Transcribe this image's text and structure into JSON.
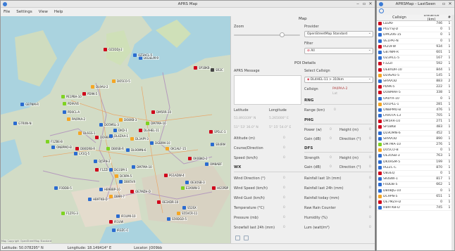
{
  "main_window": {
    "title": "APRS Map",
    "menu": [
      "File",
      "Settings",
      "View",
      "Help"
    ]
  },
  "map": {
    "copyright": "Map Copyright OpenStreetMap Standard",
    "stations": [
      {
        "label": "DO2ELM-9",
        "color": "#2a6bd1"
      },
      {
        "label": "OZ2DDJ-2",
        "color": "#d0021b"
      },
      {
        "label": "OZ3ACL-5",
        "color": "#2a6bd1"
      },
      {
        "label": "SP1BKB",
        "color": "#d0021b"
      },
      {
        "label": "SR2C",
        "color": "#444"
      },
      {
        "label": "DL9AU-2",
        "color": "#f5a623"
      },
      {
        "label": "DO5CO-5",
        "color": "#f5a623"
      },
      {
        "label": "PE1PBA-10",
        "color": "#7ed321"
      },
      {
        "label": "PD9K-5",
        "color": "#d0021b"
      },
      {
        "label": "GB7NM-R",
        "color": "#2a6bd1"
      },
      {
        "label": "PD9VVE",
        "color": "#7ed321"
      },
      {
        "label": "PD0CL-A",
        "color": "#2a6bd1"
      },
      {
        "label": "PA0PAA-2",
        "color": "#f5a623"
      },
      {
        "label": "G7RXN-N",
        "color": "#2a6bd1"
      },
      {
        "label": "F1ZBE-B",
        "color": "#7ed321"
      },
      {
        "label": "ON8PMO-B",
        "color": "#2a6bd1"
      },
      {
        "label": "DB0DRB-R",
        "color": "#d0021b"
      },
      {
        "label": "LX1CJ-5",
        "color": "#2a6bd1"
      },
      {
        "label": "DL6GS-1",
        "color": "#f5a623"
      },
      {
        "label": "DO9RAS-5",
        "color": "#d0021b"
      },
      {
        "label": "DO5MSL-3",
        "color": "#2a6bd1"
      },
      {
        "label": "DO8XB-3",
        "color": "#f5a623"
      },
      {
        "label": "DM5RR-10",
        "color": "#d0021b"
      },
      {
        "label": "DKD-1",
        "color": "#2a6bd1"
      },
      {
        "label": "DM7MA-10",
        "color": "#7ed321"
      },
      {
        "label": "DL4HEL-11",
        "color": "#d0021b"
      },
      {
        "label": "DL4ZAA-1",
        "color": "#2a6bd1"
      },
      {
        "label": "DL3APY-3",
        "color": "#f5a623"
      },
      {
        "label": "DG8RM-10",
        "color": "#2a6bd1"
      },
      {
        "label": "SP5LC-1",
        "color": "#d0021b"
      },
      {
        "label": "SR4RM",
        "color": "#2a6bd1"
      },
      {
        "label": "OK1ALF-15",
        "color": "#f5a623"
      },
      {
        "label": "DL9OMN-6",
        "color": "#2a6bd1"
      },
      {
        "label": "DB0SB-R",
        "color": "#7ed321"
      },
      {
        "label": "DM7MA-10",
        "color": "#2a6bd1"
      },
      {
        "label": "OK0BKO-2",
        "color": "#d0021b"
      },
      {
        "label": "OM8ABF",
        "color": "#2a6bd1"
      },
      {
        "label": "F1ZZI",
        "color": "#d0021b"
      },
      {
        "label": "DG1SM-1",
        "color": "#2a6bd1"
      },
      {
        "label": "DC9PA-5",
        "color": "#f5a623"
      },
      {
        "label": "DB05VX",
        "color": "#2a6bd1"
      },
      {
        "label": "PG1ADW-4",
        "color": "#d0021b"
      },
      {
        "label": "OE3OSB-3",
        "color": "#2a6bd1"
      },
      {
        "label": "E3XWW-3",
        "color": "#7ed321"
      },
      {
        "label": "HG5PBP",
        "color": "#d0021b"
      },
      {
        "label": "F0DDB-5",
        "color": "#2a6bd1"
      },
      {
        "label": "HB9BBP-10",
        "color": "#2a6bd1"
      },
      {
        "label": "DB9R-7",
        "color": "#f5a623"
      },
      {
        "label": "OE7MZH-D",
        "color": "#d0021b"
      },
      {
        "label": "HB9TKB-D",
        "color": "#2a6bd1"
      },
      {
        "label": "F1ZFG-3",
        "color": "#7ed321"
      },
      {
        "label": "IR1UMI-10",
        "color": "#2a6bd1"
      },
      {
        "label": "OE3XDR-10",
        "color": "#d0021b"
      },
      {
        "label": "S52SX",
        "color": "#2a6bd1"
      },
      {
        "label": "S55VCR-11",
        "color": "#f5a623"
      },
      {
        "label": "S59DGO-5",
        "color": "#2a6bd1"
      },
      {
        "label": "IR1UW",
        "color": "#d0021b"
      },
      {
        "label": "IR2ZC-C",
        "color": "#2a6bd1"
      },
      {
        "label": "DJ5RN-2",
        "color": "#2a6bd1"
      }
    ]
  },
  "status": {
    "latitude": "Latitude: 50.078295° N",
    "longitude": "Longitude: 18.149414° E",
    "locator": "Locator: JO09bb"
  },
  "panel": {
    "map_section": "Map",
    "zoom_label": "Zoom",
    "zoom_level": 0.75,
    "provider_label": "Provider",
    "provider_value": "OpenStreetMap Standard",
    "filter_label": "Filter",
    "filter_value": "All",
    "poi_section": "POI Details",
    "aprs_message_label": "APRS Message",
    "select_callsign_label": "Select Callsign",
    "select_callsign_value": "DL4HEL-11 > 310km",
    "callsign_label": "Callsign",
    "callsign_value": "PA0PAA-2",
    "callsign_sub": "Lat",
    "latitude_label": "Latitude",
    "longitude_label": "Longitude",
    "latitude_value": "51.893339° N",
    "longitude_value": "5.265000° E",
    "latitude_dms": "51° 53' 36.0\" N",
    "longitude_dms": "5° 15' 54.0\" E",
    "altitude_label": "Altitude (m)",
    "altitude_value": "0",
    "course_label": "Course/Direction",
    "course_value": "0",
    "speed_label": "Speed (km/h)",
    "speed_value": "0",
    "wx_header": "WX",
    "rng_header": "RNG",
    "range_label": "Range (km)",
    "range_value": "0",
    "phg_header": "PHG",
    "power_label": "Power (w)",
    "power_value": "0",
    "height_label": "Height (m)",
    "height_value": "0",
    "gain_label": "Gain (dB)",
    "gain_value": "0",
    "direction_label": "Direction (°)",
    "direction_value": "0",
    "dfs_header": "DFS",
    "strength_label": "Strength",
    "strength_value": "0",
    "dfs_height_label": "Height (m)",
    "dfs_height_value": "0",
    "dfs_gain_label": "Gain (dB)",
    "dfs_gain_value": "0",
    "dfs_direction_label": "Direction (°)",
    "dfs_direction_value": "0",
    "wx_rows": [
      {
        "label": "Wind Direction (°)",
        "value": "0"
      },
      {
        "label": "Wind Speed (km/h)",
        "value": "0"
      },
      {
        "label": "Wind Gust (km/h)",
        "value": "0"
      },
      {
        "label": "Temperature (°C)",
        "value": "0"
      },
      {
        "label": "Pressure (mb)",
        "value": "0"
      },
      {
        "label": "Snowfall last 24h (mm)",
        "value": "0"
      }
    ],
    "wx_rows_right": [
      {
        "label": "Rainfall last 1h (mm)",
        "value": "0"
      },
      {
        "label": "Rainfall last 24h (mm)",
        "value": "0"
      },
      {
        "label": "Rainfall today (mm)",
        "value": "0"
      },
      {
        "label": "Raw Rain Counter",
        "value": "0"
      },
      {
        "label": "Humidity (%)",
        "value": "0"
      },
      {
        "label": "Lum (watt/m²)",
        "value": "0"
      }
    ]
  },
  "side_window": {
    "title": "APRSMap - LastSeen",
    "columns": [
      "Callsign",
      "Distance (km)",
      "#"
    ],
    "rows": [
      {
        "call": "LD2KF",
        "dist": "746",
        "n": "1",
        "color": "#d0021b"
      },
      {
        "call": "PU2TSJ-D",
        "dist": "0",
        "n": "1",
        "color": "#2a6bd1"
      },
      {
        "call": "DPK206-15",
        "dist": "0",
        "n": "1",
        "color": "#2a6bd1"
      },
      {
        "call": "VE1PAT-N",
        "dist": "0",
        "n": "1",
        "color": "#2a6bd1"
      },
      {
        "call": "IR2UFW",
        "dist": "934",
        "n": "1",
        "color": "#d0021b"
      },
      {
        "call": "GB7NM-R",
        "dist": "601",
        "n": "1",
        "color": "#2a6bd1"
      },
      {
        "call": "OZ3ACL-5",
        "dist": "167",
        "n": "1",
        "color": "#2a6bd1"
      },
      {
        "call": "F1ZZI",
        "dist": "592",
        "n": "1",
        "color": "#d0021b"
      },
      {
        "call": "OE8XDR-10",
        "dist": "844",
        "n": "1",
        "color": "#d0021b"
      },
      {
        "call": "DL9SAU-5",
        "dist": "145",
        "n": "1",
        "color": "#f5a623"
      },
      {
        "call": "SR9VOD",
        "dist": "883",
        "n": "2",
        "color": "#2a6bd1"
      },
      {
        "call": "PD9K-5",
        "dist": "222",
        "n": "1",
        "color": "#d0021b"
      },
      {
        "call": "DO8MAR-5",
        "dist": "338",
        "n": "1",
        "color": "#d0021b"
      },
      {
        "call": "OA0YX-10",
        "dist": "0",
        "n": "1",
        "color": "#2a6bd1"
      },
      {
        "call": "DO1PLL-1",
        "dist": "281",
        "n": "1",
        "color": "#f5a623"
      },
      {
        "call": "ON8PMO-B",
        "dist": "476",
        "n": "1",
        "color": "#2a6bd1"
      },
      {
        "call": "LA9UTA-13",
        "dist": "705",
        "n": "1",
        "color": "#2a6bd1"
      },
      {
        "call": "DM5RR-10",
        "dist": "271",
        "n": "1",
        "color": "#d0021b"
      },
      {
        "call": "SP1BKB",
        "dist": "483",
        "n": "1",
        "color": "#d0021b"
      },
      {
        "call": "DL9OMN-6",
        "dist": "452",
        "n": "1",
        "color": "#2a6bd1"
      },
      {
        "call": "SR9VOD",
        "dist": "890",
        "n": "1",
        "color": "#2a6bd1"
      },
      {
        "call": "DM7MA-10",
        "dist": "276",
        "n": "1",
        "color": "#7ed321"
      },
      {
        "call": "DO5CO-B",
        "dist": "0",
        "n": "1",
        "color": "#f5a623"
      },
      {
        "call": "OE3OSB-3",
        "dist": "763",
        "n": "1",
        "color": "#2a6bd1"
      },
      {
        "call": "DK4RSM-5",
        "dist": "199",
        "n": "1",
        "color": "#2a6bd1"
      },
      {
        "call": "IR2ZC-C",
        "dist": "870",
        "n": "1",
        "color": "#2a6bd1"
      },
      {
        "call": "OB3EQ",
        "dist": "0",
        "n": "1",
        "color": "#d0021b"
      },
      {
        "call": "SK4BW-1",
        "dist": "817",
        "n": "1",
        "color": "#2a6bd1"
      },
      {
        "call": "F0DDB-5",
        "dist": "662",
        "n": "1",
        "color": "#2a6bd1"
      },
      {
        "call": "DB0BJG-10",
        "dist": "0",
        "n": "1",
        "color": "#2a6bd1"
      },
      {
        "call": "DC9PN-5",
        "dist": "651",
        "n": "1",
        "color": "#f5a623"
      },
      {
        "call": "OE7MZH-D",
        "dist": "0",
        "n": "1",
        "color": "#d0021b"
      },
      {
        "call": "HB9TKB-D",
        "dist": "745",
        "n": "1",
        "color": "#2a6bd1"
      }
    ]
  }
}
